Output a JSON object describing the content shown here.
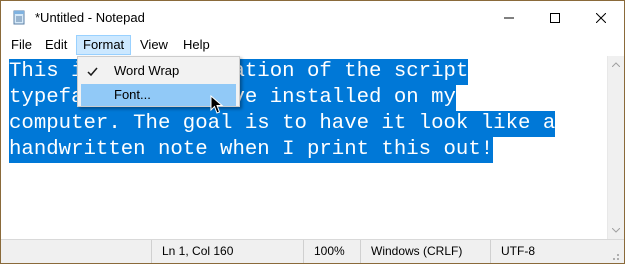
{
  "window": {
    "title": "*Untitled - Notepad",
    "icons": {
      "app": "notepad-icon",
      "minimize": "minimize-icon",
      "maximize": "maximize-icon",
      "close": "close-icon"
    }
  },
  "menubar": {
    "items": [
      {
        "label": "File"
      },
      {
        "label": "Edit"
      },
      {
        "label": "Format",
        "active": true
      },
      {
        "label": "View"
      },
      {
        "label": "Help"
      }
    ]
  },
  "format_menu": {
    "items": [
      {
        "label": "Word Wrap",
        "checked": true
      },
      {
        "label": "Font...",
        "hovered": true
      }
    ]
  },
  "editor": {
    "selected": true,
    "lines": [
      "This is a demonstration of the script",
      "typeface that I have installed on my",
      "computer. The goal is to have it look like a",
      "handwritten note when I print this out!"
    ]
  },
  "statusbar": {
    "position": "Ln 1, Col 160",
    "zoom": "100%",
    "line_ending": "Windows (CRLF)",
    "encoding": "UTF-8"
  },
  "colors": {
    "selection": "#0078d7",
    "menu_active": "#cce8ff",
    "menu_hover": "#91c9f7"
  }
}
